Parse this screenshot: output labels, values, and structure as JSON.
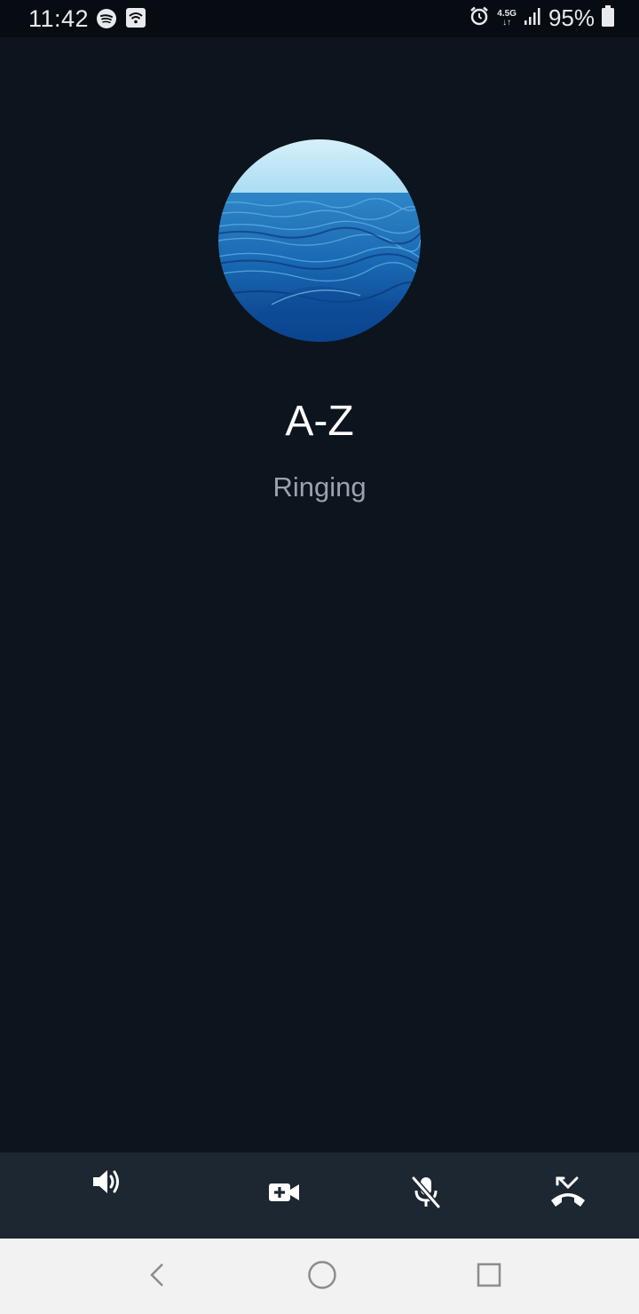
{
  "status_bar": {
    "time": "11:42",
    "network": "4.5G",
    "battery": "95%",
    "icons": [
      "spotify-icon",
      "wifi-cast-icon",
      "alarm-icon",
      "signal-icon",
      "battery-icon"
    ]
  },
  "call": {
    "contact_name": "A-Z",
    "status": "Ringing",
    "avatar": "ocean-waves-photo"
  },
  "controls": [
    {
      "id": "speaker",
      "icon": "speaker-icon"
    },
    {
      "id": "video",
      "icon": "video-add-icon"
    },
    {
      "id": "mute",
      "icon": "mic-off-icon"
    },
    {
      "id": "end",
      "icon": "end-call-icon"
    }
  ],
  "nav": [
    "back",
    "home",
    "recents"
  ],
  "colors": {
    "background": "#0c141d",
    "controls_bar": "#1d2731",
    "status_text": "#9aa3ad"
  }
}
